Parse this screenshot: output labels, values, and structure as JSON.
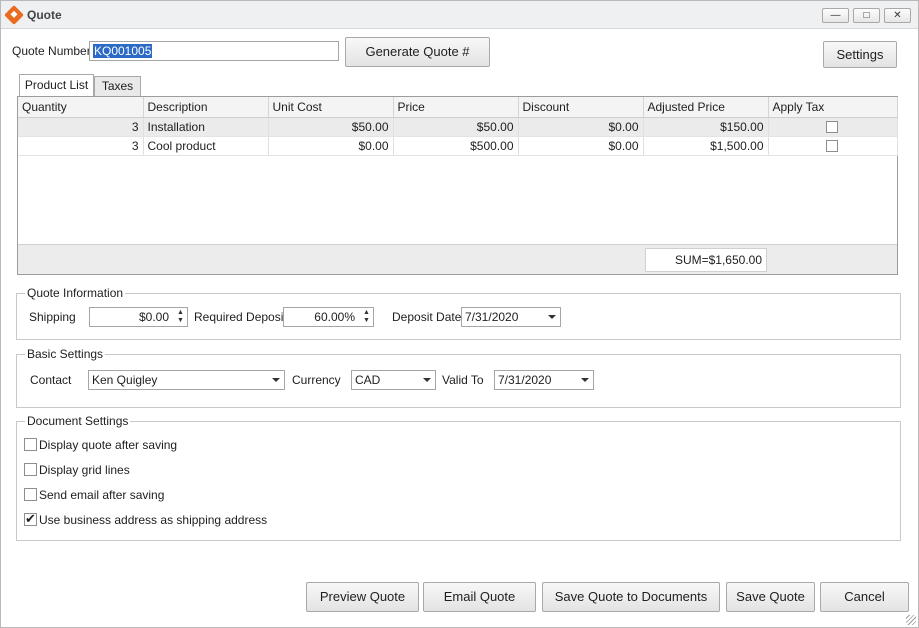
{
  "window": {
    "title": "Quote",
    "minimize_icon": "minimize-icon",
    "maximize_icon": "maximize-icon",
    "close_icon": "close-icon"
  },
  "header": {
    "quote_number_label": "Quote Number",
    "quote_number_value": "KQ001005",
    "generate_button": "Generate Quote #",
    "settings_button": "Settings"
  },
  "tabs": [
    {
      "label": "Product List",
      "active": true
    },
    {
      "label": "Taxes",
      "active": false
    }
  ],
  "grid": {
    "columns": [
      "Quantity",
      "Description",
      "Unit Cost",
      "Price",
      "Discount",
      "Adjusted Price",
      "Apply Tax"
    ],
    "rows": [
      {
        "quantity": "3",
        "description": "Installation",
        "unit_cost": "$50.00",
        "price": "$50.00",
        "discount": "$0.00",
        "adjusted_price": "$150.00",
        "apply_tax": false
      },
      {
        "quantity": "3",
        "description": "Cool product",
        "unit_cost": "$0.00",
        "price": "$500.00",
        "discount": "$0.00",
        "adjusted_price": "$1,500.00",
        "apply_tax": false
      }
    ],
    "sum": "SUM=$1,650.00"
  },
  "quote_info": {
    "title": "Quote Information",
    "shipping_label": "Shipping",
    "shipping_value": "$0.00",
    "deposit_label": "Required Deposit",
    "deposit_value": "60.00%",
    "deposit_date_label": "Deposit Date",
    "deposit_date_value": "7/31/2020"
  },
  "basic_settings": {
    "title": "Basic Settings",
    "contact_label": "Contact",
    "contact_value": "Ken Quigley",
    "currency_label": "Currency",
    "currency_value": "CAD",
    "valid_to_label": "Valid To",
    "valid_to_value": "7/31/2020"
  },
  "document_settings": {
    "title": "Document Settings",
    "options": [
      {
        "label": "Display quote after saving",
        "checked": false
      },
      {
        "label": "Display grid lines",
        "checked": false
      },
      {
        "label": "Send email after saving",
        "checked": false
      },
      {
        "label": "Use business address as shipping address",
        "checked": true
      }
    ]
  },
  "actions": {
    "preview": "Preview Quote",
    "email": "Email Quote",
    "save_documents": "Save Quote to Documents",
    "save": "Save Quote",
    "cancel": "Cancel"
  },
  "colors": {
    "accent": "#e86b1f",
    "selection": "#2b6bc5"
  }
}
